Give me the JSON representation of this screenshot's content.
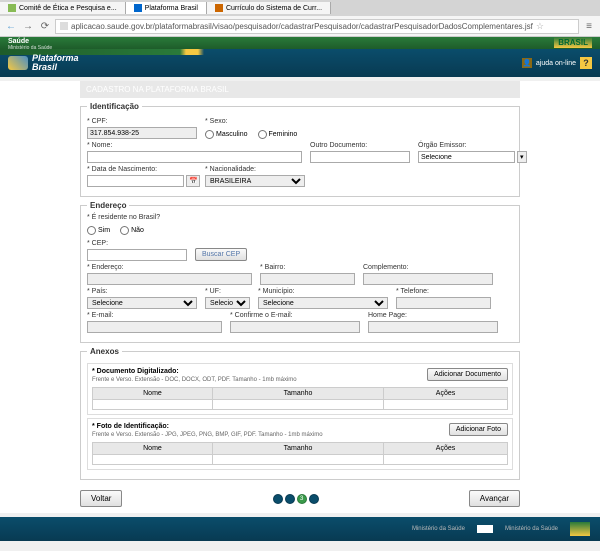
{
  "browser": {
    "tabs": [
      {
        "label": "Comitê de Ética e Pesquisa e..."
      },
      {
        "label": "Plataforma Brasil"
      },
      {
        "label": "Currículo do Sistema de Curr..."
      }
    ],
    "url": "aplicacao.saude.gov.br/plataformabrasil/visao/pesquisador/cadastrarPesquisador/cadastrarPesquisadorDadosComplementares.jsf"
  },
  "header": {
    "ministry": "Saúde",
    "ministry_sub": "Ministério da Saúde",
    "brand1": "Plataforma",
    "brand2": "Brasil",
    "help": "ajuda on-line",
    "flag": "BRASIL"
  },
  "page_title": "CADASTRO NA PLATAFORMA BRASIL",
  "ident": {
    "legend": "Identificação",
    "cpf_label": "CPF:",
    "cpf_value": "317.854.938-25",
    "sexo_label": "Sexo:",
    "sexo_m": "Masculino",
    "sexo_f": "Feminino",
    "nome_label": "Nome:",
    "outro_doc_label": "Outro Documento:",
    "orgao_label": "Órgão Emissor:",
    "orgao_value": "Selecione",
    "nasc_label": "Data de Nascimento:",
    "nac_label": "Nacionalidade:",
    "nac_value": "BRASILEIRA"
  },
  "end": {
    "legend": "Endereço",
    "residente_label": "É residente no Brasil?",
    "sim": "Sim",
    "nao": "Não",
    "cep_label": "CEP:",
    "buscar_cep": "Buscar CEP",
    "endereco_label": "Endereço:",
    "bairro_label": "Bairro:",
    "comp_label": "Complemento:",
    "pais_label": "País:",
    "pais_ph": "Selecione",
    "uf_label": "UF:",
    "uf_ph": "Selecione",
    "mun_label": "Município:",
    "mun_ph": "Selecione",
    "tel_label": "Telefone:",
    "email_label": "E-mail:",
    "conf_email_label": "Confirme o E-mail:",
    "home_label": "Home Page:"
  },
  "anexos": {
    "legend": "Anexos",
    "doc_title": "Documento Digitalizado:",
    "doc_hint": "Frente e Verso. Extensão - DOC, DOCX, ODT, PDF. Tamanho - 1mb máximo",
    "add_doc": "Adicionar Documento",
    "foto_title": "Foto de Identificação:",
    "foto_hint": "Frente e Verso. Extensão - JPG, JPEG, PNG, BMP, GIF, PDF. Tamanho - 1mb máximo",
    "add_foto": "Adicionar Foto",
    "col_nome": "Nome",
    "col_tam": "Tamanho",
    "col_acoes": "Ações"
  },
  "actions": {
    "voltar": "Voltar",
    "avancar": "Avançar",
    "current_step": "3"
  },
  "footer": {
    "item1": "Ministério da Saúde",
    "item2": "sus",
    "item3": "Ministério da Saúde"
  }
}
